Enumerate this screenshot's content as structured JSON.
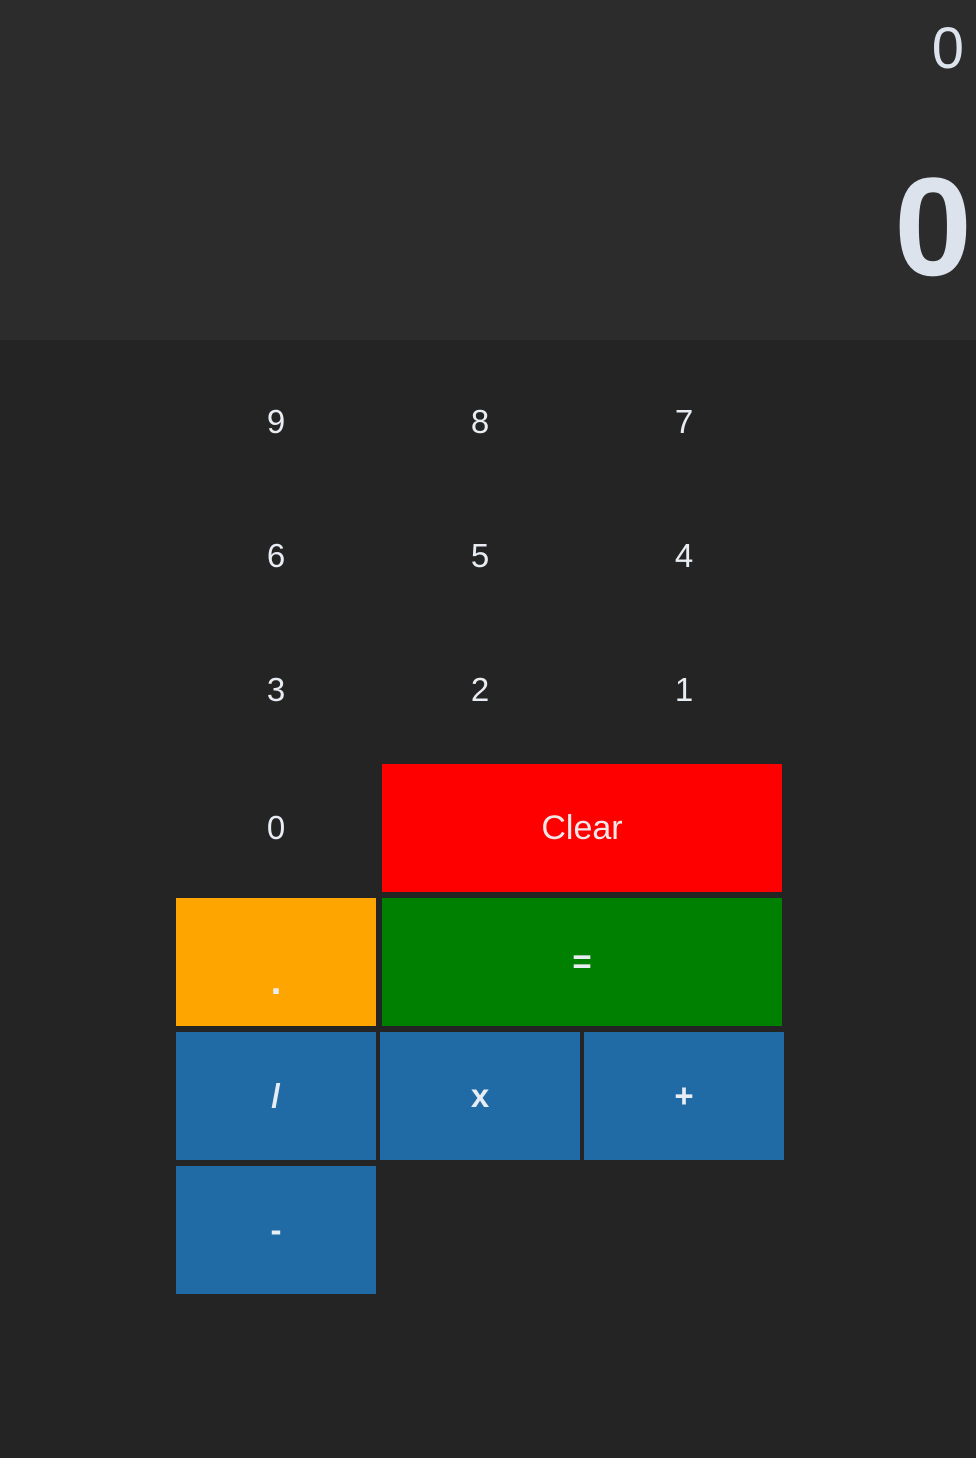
{
  "display": {
    "previous": "0",
    "current": "0"
  },
  "keys": {
    "nine": "9",
    "eight": "8",
    "seven": "7",
    "six": "6",
    "five": "5",
    "four": "4",
    "three": "3",
    "two": "2",
    "one": "1",
    "zero": "0",
    "clear": "Clear",
    "dot": ".",
    "equals": "=",
    "divide": "/",
    "multiply": "x",
    "add": "+",
    "subtract": "-"
  },
  "colors": {
    "clear": "#ff0000",
    "dot": "#ffa500",
    "equals": "#008000",
    "operator": "#206aa6"
  }
}
